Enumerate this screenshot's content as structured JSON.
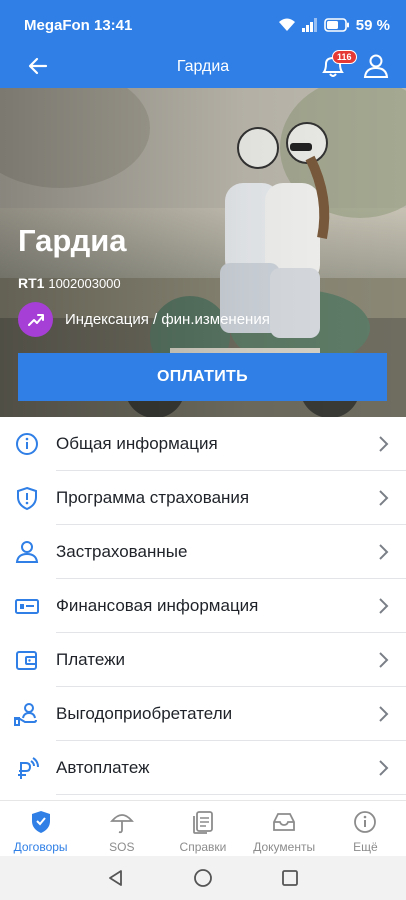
{
  "status_bar": {
    "carrier_time": "MegaFon 13:41",
    "battery": "59 %"
  },
  "app_bar": {
    "title": "Гардиа",
    "notification_count": "116"
  },
  "hero": {
    "title": "Гардиа",
    "contract_prefix": "RT1",
    "contract_number": "1002003000",
    "indexation_label": "Индексация / фин.изменения",
    "pay_button": "ОПЛАТИТЬ"
  },
  "menu": {
    "items": [
      {
        "label": "Общая информация",
        "icon": "info-icon"
      },
      {
        "label": "Программа страхования",
        "icon": "shield-icon"
      },
      {
        "label": "Застрахованные",
        "icon": "person-icon"
      },
      {
        "label": "Финансовая информация",
        "icon": "money-icon"
      },
      {
        "label": "Платежи",
        "icon": "wallet-icon"
      },
      {
        "label": "Выгодоприобретатели",
        "icon": "beneficiary-icon"
      },
      {
        "label": "Автоплатеж",
        "icon": "ruble-autopay-icon"
      }
    ]
  },
  "bottom_nav": {
    "items": [
      {
        "label": "Договоры",
        "icon": "contract-shield-icon",
        "active": true
      },
      {
        "label": "SOS",
        "icon": "umbrella-icon",
        "active": false
      },
      {
        "label": "Справки",
        "icon": "documents-icon",
        "active": false
      },
      {
        "label": "Документы",
        "icon": "inbox-icon",
        "active": false
      },
      {
        "label": "Ещё",
        "icon": "info-more-icon",
        "active": false
      }
    ]
  },
  "colors": {
    "primary": "#2f7fe6",
    "indexation_icon": "#a53fd6",
    "badge": "#e53935"
  }
}
